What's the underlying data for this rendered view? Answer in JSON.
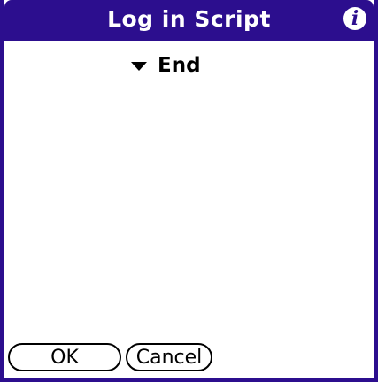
{
  "dialog": {
    "title": "Log in Script",
    "info_icon": "info-icon"
  },
  "script": {
    "trigger_label": "End"
  },
  "buttons": {
    "ok_label": "OK",
    "cancel_label": "Cancel"
  },
  "colors": {
    "title_bar": "#2c0e8e",
    "frame": "#2c0e8e",
    "background": "#ffffff",
    "text": "#000000"
  }
}
